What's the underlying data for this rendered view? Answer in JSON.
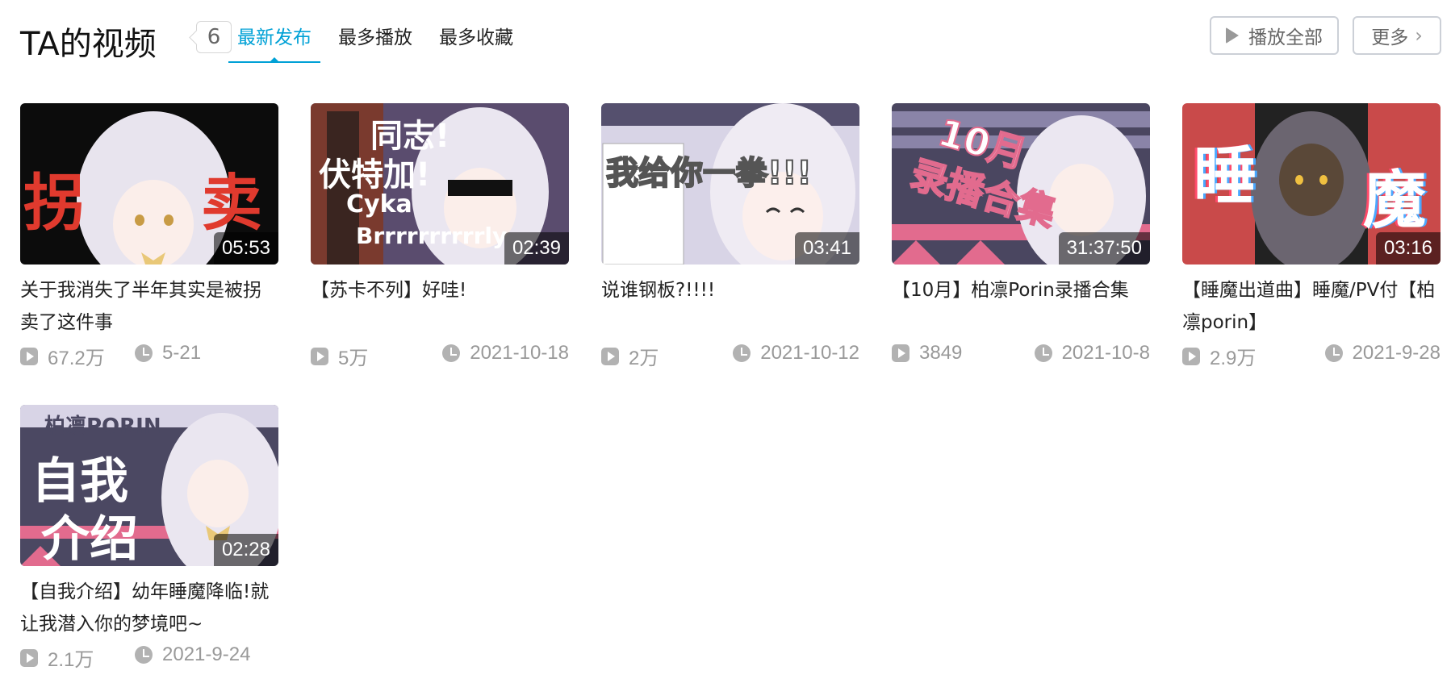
{
  "header": {
    "title": "TA的视频",
    "count": "6",
    "tabs": [
      {
        "label": "最新发布",
        "active": true
      },
      {
        "label": "最多播放",
        "active": false
      },
      {
        "label": "最多收藏",
        "active": false
      }
    ],
    "play_all_label": "播放全部",
    "more_label": "更多"
  },
  "colors": {
    "accent": "#00a1d6",
    "meta_gray": "#999999",
    "border": "#ccd0d7"
  },
  "videos": [
    {
      "title": "关于我消失了半年其实是被拐卖了这件事",
      "duration": "05:53",
      "plays": "67.2万",
      "date": "5-21",
      "thumb_text": [
        "拐",
        "卖"
      ]
    },
    {
      "title": "【苏卡不列】好哇!",
      "duration": "02:39",
      "plays": "5万",
      "date": "2021-10-18",
      "thumb_text": [
        "同志!",
        "伏特加!",
        "Cyka",
        "Brrrrrrrrrrly"
      ]
    },
    {
      "title": "说谁钢板?!!!!",
      "duration": "03:41",
      "plays": "2万",
      "date": "2021-10-12",
      "thumb_text": [
        "我给你一拳!!!"
      ]
    },
    {
      "title": "【10月】柏凛Porin录播合集",
      "duration": "31:37:50",
      "plays": "3849",
      "date": "2021-10-8",
      "thumb_text": [
        "10月",
        "录播合集"
      ]
    },
    {
      "title": "【睡魔出道曲】睡魔/PV付【柏凛porin】",
      "duration": "03:16",
      "plays": "2.9万",
      "date": "2021-9-28",
      "thumb_text": [
        "睡",
        "魔"
      ]
    },
    {
      "title": "【自我介绍】幼年睡魔降临!就让我潜入你的梦境吧~",
      "duration": "02:28",
      "plays": "2.1万",
      "date": "2021-9-24",
      "thumb_text": [
        "柏凛PORIN",
        "自我",
        "介绍"
      ]
    }
  ]
}
